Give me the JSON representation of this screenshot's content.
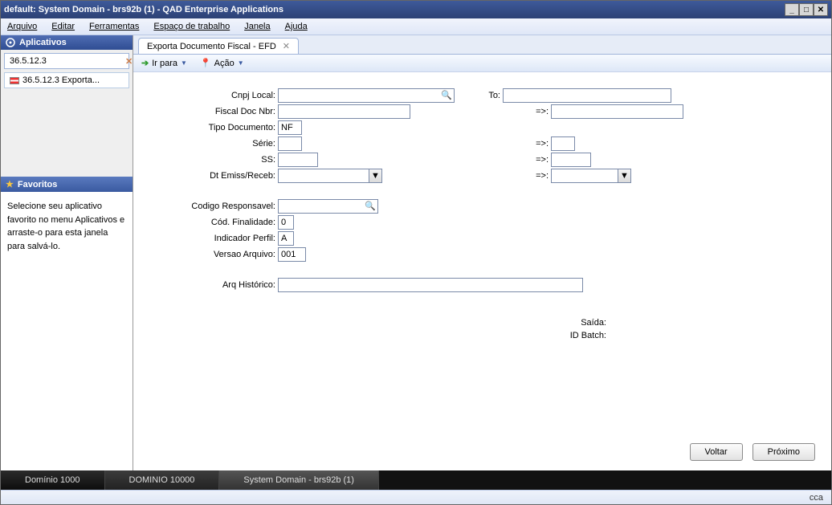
{
  "window": {
    "title": "default: System Domain - brs92b (1) - QAD Enterprise Applications"
  },
  "menubar": [
    "Arquivo",
    "Editar",
    "Ferramentas",
    "Espaço de trabalho",
    "Janela",
    "Ajuda"
  ],
  "sidebar": {
    "apps_header": "Aplicativos",
    "search_value": "36.5.12.3",
    "tree_item": "36.5.12.3  Exporta...",
    "fav_header": "Favoritos",
    "fav_text": "Selecione seu aplicativo favorito no menu Aplicativos e arraste-o para esta janela para salvá-lo."
  },
  "tab": {
    "label": "Exporta Documento Fiscal - EFD"
  },
  "toolbar": {
    "irpara": "Ir para",
    "acao": "Ação"
  },
  "form": {
    "cnpj_local_lbl": "Cnpj Local:",
    "cnpj_local_val": "",
    "to_lbl": "To:",
    "to_val": "",
    "fiscal_doc_lbl": "Fiscal Doc Nbr:",
    "fiscal_doc_val": "",
    "fiscal_doc_to_lbl": "=>:",
    "fiscal_doc_to_val": "",
    "tipo_doc_lbl": "Tipo Documento:",
    "tipo_doc_val": "NF",
    "serie_lbl": "Série:",
    "serie_val": "",
    "serie_to_lbl": "=>:",
    "serie_to_val": "",
    "ss_lbl": "SS:",
    "ss_val": "",
    "ss_to_lbl": "=>:",
    "ss_to_val": "",
    "dt_lbl": "Dt Emiss/Receb:",
    "dt_val": "",
    "dt_to_lbl": "=>:",
    "dt_to_val": "",
    "cod_resp_lbl": "Codigo Responsavel:",
    "cod_resp_val": "",
    "cod_fin_lbl": "Cód. Finalidade:",
    "cod_fin_val": "0",
    "ind_perfil_lbl": "Indicador Perfil:",
    "ind_perfil_val": "A",
    "versao_lbl": "Versao Arquivo:",
    "versao_val": "001",
    "arq_lbl": "Arq Histórico:",
    "arq_val": "",
    "saida_lbl": "Saída:",
    "idbatch_lbl": "ID Batch:"
  },
  "buttons": {
    "voltar": "Voltar",
    "proximo": "Próximo"
  },
  "statusbar": {
    "tabs": [
      "Domínio 1000",
      "DOMINIO 10000",
      "System Domain - brs92b (1)"
    ]
  },
  "footer": {
    "text": "cca"
  }
}
